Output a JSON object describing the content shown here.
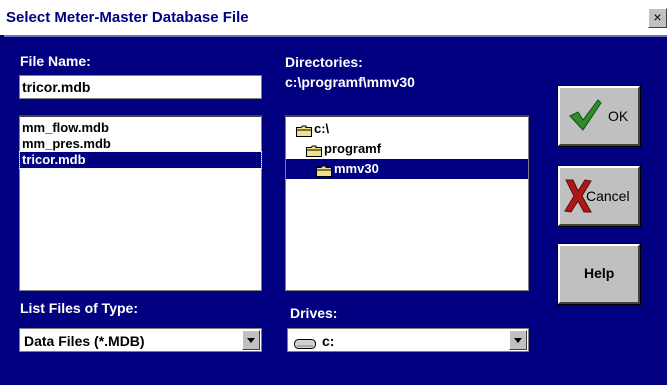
{
  "window": {
    "title": "Select Meter-Master Database File",
    "close_glyph": "×"
  },
  "file_name": {
    "label": "File Name:",
    "value": "tricor.mdb",
    "files": [
      "mm_flow.mdb",
      "mm_pres.mdb",
      "tricor.mdb"
    ],
    "selected_index": 2
  },
  "directories": {
    "label": "Directories:",
    "current_path": "c:\\programf\\mmv30",
    "items": [
      "c:\\",
      "programf",
      "mmv30"
    ],
    "selected_index": 2
  },
  "file_type": {
    "label": "List Files of Type:",
    "value": "Data Files (*.MDB)"
  },
  "drives": {
    "label": "Drives:",
    "value": "c:"
  },
  "buttons": {
    "ok_label": "OK",
    "cancel_label": "Cancel",
    "help_label": "Help"
  },
  "colors": {
    "window_bg": "#000080",
    "selection": "#000080",
    "button_face": "#c0c0c0",
    "ok_check": "#2e8b2e",
    "cancel_x": "#b01818"
  },
  "icons": {
    "ok": "green-checkmark-icon",
    "cancel": "red-x-icon",
    "folder": "folder-icon",
    "drive": "hard-drive-icon"
  }
}
